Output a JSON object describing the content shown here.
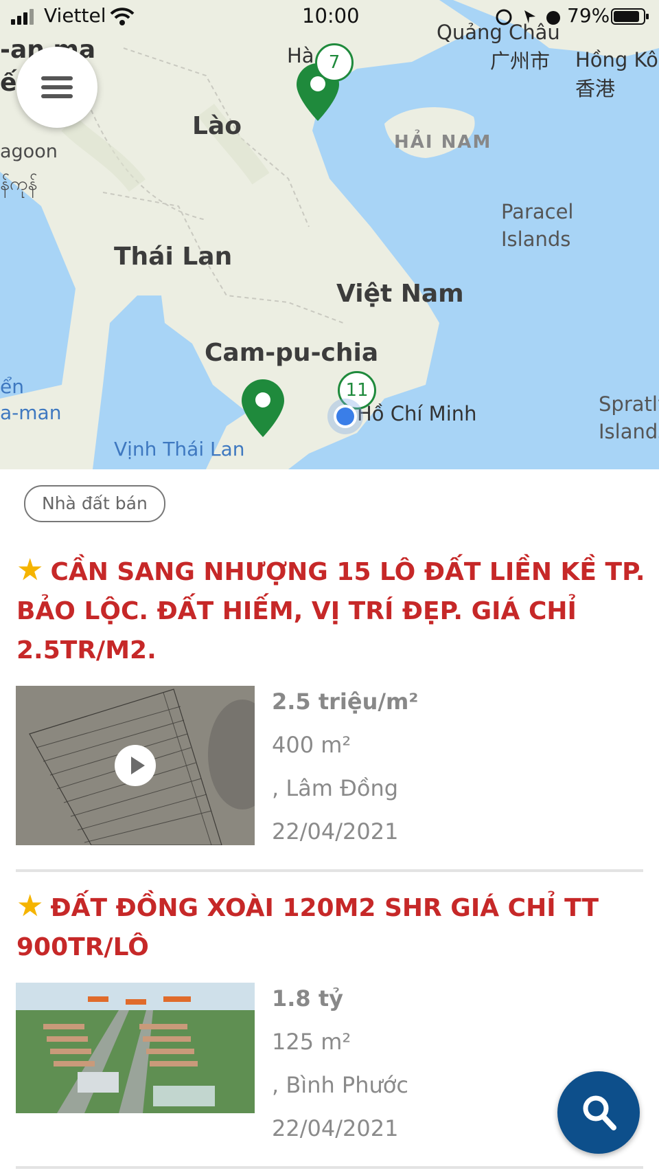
{
  "status_bar": {
    "carrier": "Viettel",
    "time": "10:00",
    "battery": "79%"
  },
  "map": {
    "labels": {
      "top_left_1": "-an ma",
      "top_left_2": "ến",
      "lagoon": "agoon",
      "burmese": "န်ကုန်",
      "lao": "Lào",
      "ha_noi": "Hà",
      "quang_chau": "Quảng Châu",
      "quang_chau_cn": "广州市",
      "hong_kong": "Hồng Kô",
      "hong_kong_cn": "香港",
      "hai_nam": "HẢI NAM",
      "paracel_1": "Paracel",
      "paracel_2": "Islands",
      "thai_lan": "Thái Lan",
      "viet_nam": "Việt Nam",
      "cam_pu_chia": "Cam-pu-chia",
      "bien_1": "ển",
      "bien_2": "a-man",
      "vinh_thai_lan": "Vịnh Thái Lan",
      "ho_chi_minh": "Hồ Chí Minh",
      "spratly_1": "Spratly",
      "spratly_2": "Islands"
    },
    "clusters": {
      "north": "7",
      "south": "11"
    },
    "colors": {
      "water": "#a8d4f6",
      "land": "#ecefe4",
      "pin": "#1f8a3c"
    }
  },
  "category_tag": "Nhà đất bán",
  "listings": [
    {
      "star": "★",
      "title": "CẦN SANG NHƯỢNG 15 LÔ ĐẤT LIỀN KỀ TP. BẢO LỘC. ĐẤT HIẾM, VỊ TRÍ ĐẸP. GIÁ CHỈ 2.5TR/M2.",
      "price": "2.5 triệu/m²",
      "area": "400 m²",
      "location": ", Lâm Đồng",
      "date": "22/04/2021"
    },
    {
      "star": "★",
      "title": "ĐẤT ĐỒNG XOÀI 120M2 SHR GIÁ CHỈ TT 900TR/LÔ",
      "price": "1.8 tỷ",
      "area": "125 m²",
      "location": ", Bình Phước",
      "date": "22/04/2021"
    }
  ],
  "colors": {
    "title_red": "#c62828",
    "star_yellow": "#f5b400",
    "fab_blue": "#0d4f8b"
  },
  "icons": {
    "menu": "hamburger-icon",
    "search": "search-icon",
    "play": "play-icon",
    "pin": "map-pin-icon"
  }
}
